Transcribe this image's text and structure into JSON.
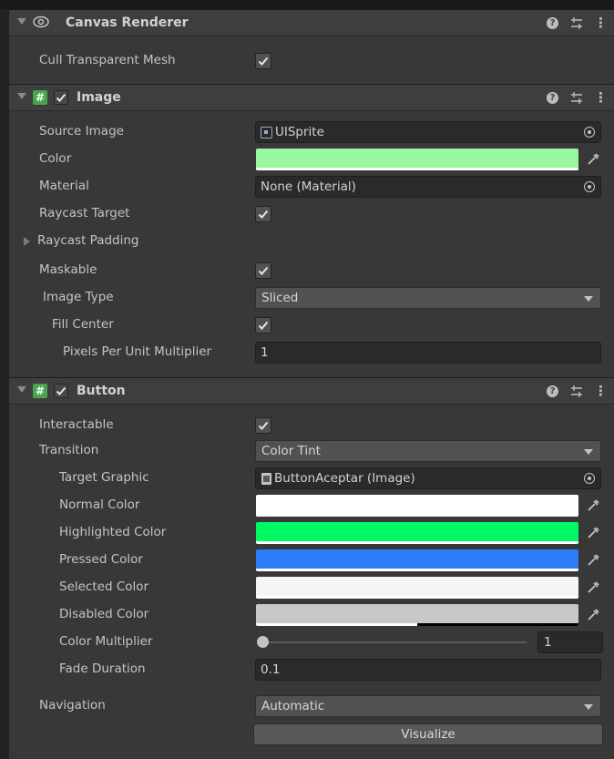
{
  "components": {
    "canvas_renderer": {
      "title": "Canvas Renderer",
      "cull_label": "Cull Transparent Mesh",
      "cull_checked": true
    },
    "image": {
      "title": "Image",
      "enabled": true,
      "source_image_label": "Source Image",
      "source_image_value": "UISprite",
      "color_label": "Color",
      "color_value": "#99f7a0",
      "material_label": "Material",
      "material_value": "None (Material)",
      "raycast_target_label": "Raycast Target",
      "raycast_target_checked": true,
      "raycast_padding_label": "Raycast Padding",
      "maskable_label": "Maskable",
      "maskable_checked": true,
      "image_type_label": "Image Type",
      "image_type_value": "Sliced",
      "fill_center_label": "Fill Center",
      "fill_center_checked": true,
      "ppu_label": "Pixels Per Unit Multiplier",
      "ppu_value": "1"
    },
    "button": {
      "title": "Button",
      "enabled": true,
      "interactable_label": "Interactable",
      "interactable_checked": true,
      "transition_label": "Transition",
      "transition_value": "Color Tint",
      "target_graphic_label": "Target Graphic",
      "target_graphic_value": "ButtonAceptar (Image)",
      "normal_color_label": "Normal Color",
      "normal_color_value": "#ffffff",
      "highlighted_color_label": "Highlighted Color",
      "highlighted_color_value": "#00fa64",
      "pressed_color_label": "Pressed Color",
      "pressed_color_value": "#2f7cf7",
      "selected_color_label": "Selected Color",
      "selected_color_value": "#f5f5f5",
      "disabled_color_label": "Disabled Color",
      "disabled_color_value": "#c8c8c8",
      "disabled_color_alpha": 0.5,
      "color_multiplier_label": "Color Multiplier",
      "color_multiplier_value": "1",
      "color_multiplier_level": 0.0,
      "fade_duration_label": "Fade Duration",
      "fade_duration_value": "0.1",
      "navigation_label": "Navigation",
      "navigation_value": "Automatic",
      "visualize_label": "Visualize"
    }
  }
}
